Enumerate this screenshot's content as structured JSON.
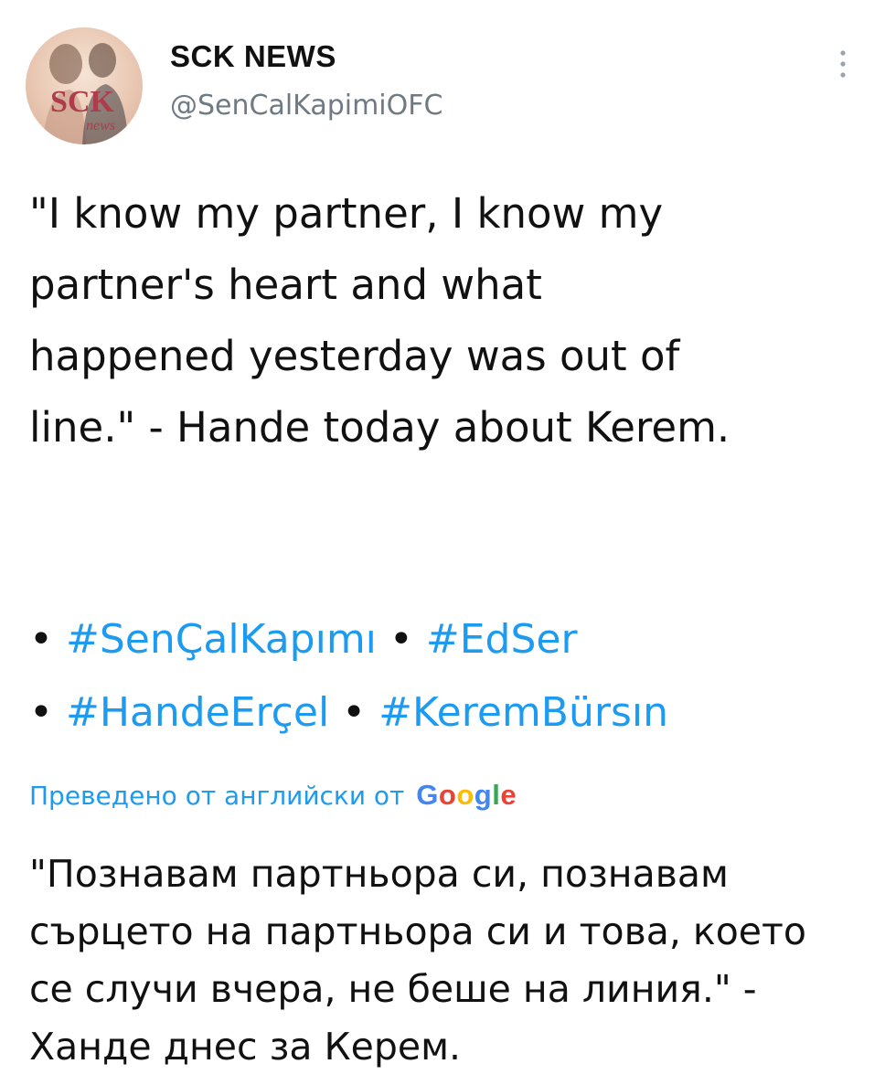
{
  "author": {
    "display_name": "SCK NEWS",
    "handle": "@SenCalKapimiOFC",
    "avatar_label": "SCK",
    "avatar_sublabel": "news"
  },
  "menu": {
    "icon": "more-vertical-icon"
  },
  "tweet": {
    "text": "\"I know my partner, I know my partner's heart and what happened yesterday was out of line.\" - Hande today about Kerem.",
    "bullet": "•",
    "hashtags": [
      "#SenÇalKapımı",
      "#EdSer",
      "#HandeErçel",
      "#KeremBürsın"
    ]
  },
  "translation": {
    "label": "Преведено от английски от",
    "provider": "Google",
    "text": "\"Познавам партньора си, познавам сърцето на партньора си и това, което се случи вчера, не беше на линия.\" - Ханде днес за Керем."
  },
  "colors": {
    "link": "#1d9bf0",
    "text": "#111111",
    "secondary": "#6f7a84",
    "google_blue": "#4285f4",
    "google_red": "#ea4335",
    "google_yellow": "#fbbc05",
    "google_green": "#34a853"
  }
}
